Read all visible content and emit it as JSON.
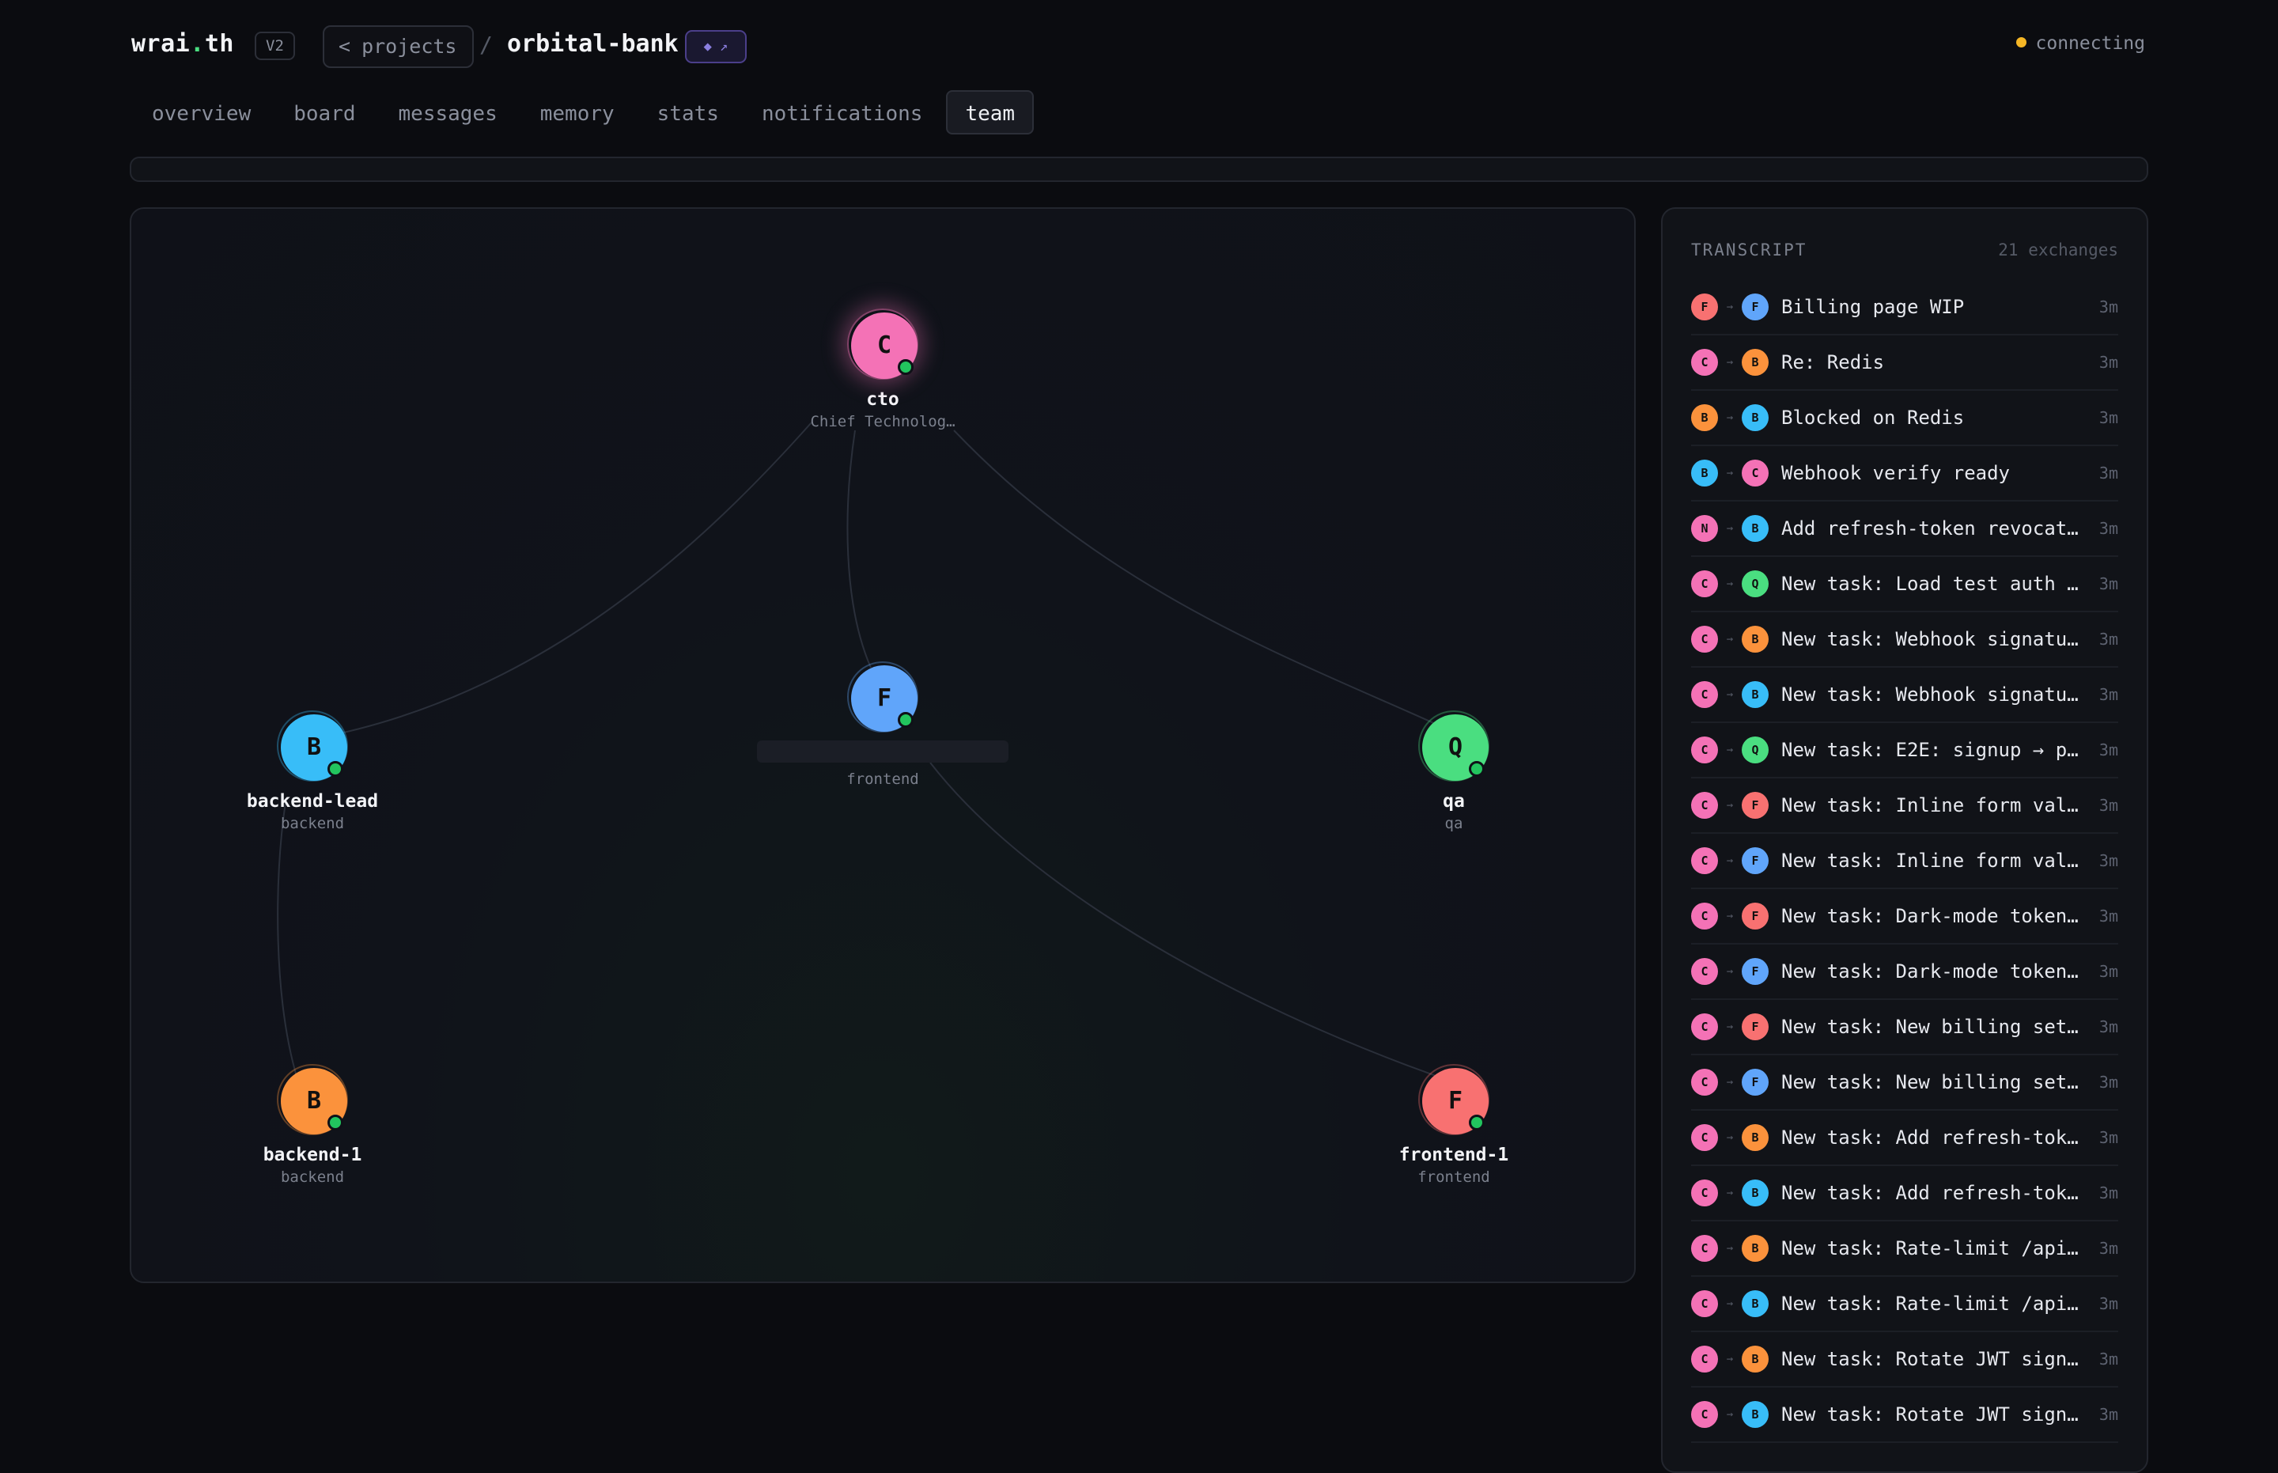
{
  "header": {
    "brand_a": "wrai",
    "brand_dot": ".",
    "brand_b": "th",
    "version": "V2",
    "back_label": "projects",
    "separator": "/",
    "project_name": "orbital-bank",
    "project_badge": "◆ ↗",
    "status_text": "connecting",
    "status_color": "#f5b625"
  },
  "tabs": [
    {
      "label": "overview",
      "active": false
    },
    {
      "label": "board",
      "active": false
    },
    {
      "label": "messages",
      "active": false
    },
    {
      "label": "memory",
      "active": false
    },
    {
      "label": "stats",
      "active": false
    },
    {
      "label": "notifications",
      "active": false
    },
    {
      "label": "team",
      "active": true
    }
  ],
  "graph": {
    "nodes": [
      {
        "id": "cto",
        "initial": "C",
        "name": "cto",
        "role": "Chief Technolog…",
        "color": "#f472b6",
        "online": true
      },
      {
        "id": "frontend-lead",
        "initial": "F",
        "name": "",
        "role": "frontend",
        "color": "#60a5fa",
        "online": true
      },
      {
        "id": "backend-lead",
        "initial": "B",
        "name": "backend-lead",
        "role": "backend",
        "color": "#38bdf8",
        "online": true
      },
      {
        "id": "qa",
        "initial": "Q",
        "name": "qa",
        "role": "qa",
        "color": "#4ade80",
        "online": true
      },
      {
        "id": "backend-1",
        "initial": "B",
        "name": "backend-1",
        "role": "backend",
        "color": "#fb923c",
        "online": true
      },
      {
        "id": "frontend-1",
        "initial": "F",
        "name": "frontend-1",
        "role": "frontend",
        "color": "#f87171",
        "online": true
      }
    ]
  },
  "transcript": {
    "title": "TRANSCRIPT",
    "count": "21 exchanges",
    "arrow": "→",
    "items": [
      {
        "from": "F",
        "from_color": "#f87171",
        "to": "F",
        "to_color": "#60a5fa",
        "subject": "Billing page WIP",
        "time": "3m"
      },
      {
        "from": "C",
        "from_color": "#f472b6",
        "to": "B",
        "to_color": "#fb923c",
        "subject": "Re: Redis",
        "time": "3m"
      },
      {
        "from": "B",
        "from_color": "#fb923c",
        "to": "B",
        "to_color": "#38bdf8",
        "subject": "Blocked on Redis",
        "time": "3m"
      },
      {
        "from": "B",
        "from_color": "#38bdf8",
        "to": "C",
        "to_color": "#f472b6",
        "subject": "Webhook verify ready",
        "time": "3m"
      },
      {
        "from": "N",
        "from_color": "#f472b6",
        "to": "B",
        "to_color": "#38bdf8",
        "subject": "Add refresh-token revocati…",
        "time": "3m"
      },
      {
        "from": "C",
        "from_color": "#f472b6",
        "to": "Q",
        "to_color": "#4ade80",
        "subject": "New task: Load test auth e…",
        "time": "3m"
      },
      {
        "from": "C",
        "from_color": "#f472b6",
        "to": "B",
        "to_color": "#fb923c",
        "subject": "New task: Webhook signatur…",
        "time": "3m"
      },
      {
        "from": "C",
        "from_color": "#f472b6",
        "to": "B",
        "to_color": "#38bdf8",
        "subject": "New task: Webhook signatur…",
        "time": "3m"
      },
      {
        "from": "C",
        "from_color": "#f472b6",
        "to": "Q",
        "to_color": "#4ade80",
        "subject": "New task: E2E: signup → pa…",
        "time": "3m"
      },
      {
        "from": "C",
        "from_color": "#f472b6",
        "to": "F",
        "to_color": "#f87171",
        "subject": "New task: Inline form vali…",
        "time": "3m"
      },
      {
        "from": "C",
        "from_color": "#f472b6",
        "to": "F",
        "to_color": "#60a5fa",
        "subject": "New task: Inline form vali…",
        "time": "3m"
      },
      {
        "from": "C",
        "from_color": "#f472b6",
        "to": "F",
        "to_color": "#f87171",
        "subject": "New task: Dark-mode token …",
        "time": "3m"
      },
      {
        "from": "C",
        "from_color": "#f472b6",
        "to": "F",
        "to_color": "#60a5fa",
        "subject": "New task: Dark-mode token …",
        "time": "3m"
      },
      {
        "from": "C",
        "from_color": "#f472b6",
        "to": "F",
        "to_color": "#f87171",
        "subject": "New task: New billing sett…",
        "time": "3m"
      },
      {
        "from": "C",
        "from_color": "#f472b6",
        "to": "F",
        "to_color": "#60a5fa",
        "subject": "New task: New billing sett…",
        "time": "3m"
      },
      {
        "from": "C",
        "from_color": "#f472b6",
        "to": "B",
        "to_color": "#fb923c",
        "subject": "New task: Add refresh-toke…",
        "time": "3m"
      },
      {
        "from": "C",
        "from_color": "#f472b6",
        "to": "B",
        "to_color": "#38bdf8",
        "subject": "New task: Add refresh-toke…",
        "time": "3m"
      },
      {
        "from": "C",
        "from_color": "#f472b6",
        "to": "B",
        "to_color": "#fb923c",
        "subject": "New task: Rate-limit /api/…",
        "time": "3m"
      },
      {
        "from": "C",
        "from_color": "#f472b6",
        "to": "B",
        "to_color": "#38bdf8",
        "subject": "New task: Rate-limit /api/…",
        "time": "3m"
      },
      {
        "from": "C",
        "from_color": "#f472b6",
        "to": "B",
        "to_color": "#fb923c",
        "subject": "New task: Rotate JWT signi…",
        "time": "3m"
      },
      {
        "from": "C",
        "from_color": "#f472b6",
        "to": "B",
        "to_color": "#38bdf8",
        "subject": "New task: Rotate JWT signi…",
        "time": "3m"
      }
    ]
  }
}
